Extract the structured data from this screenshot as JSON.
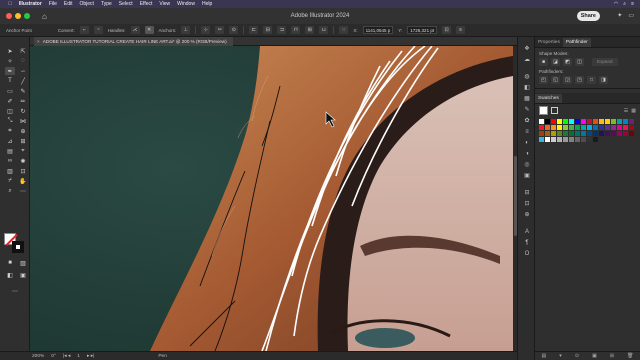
{
  "menubar": {
    "apple": "",
    "items": [
      "Illustrator",
      "File",
      "Edit",
      "Object",
      "Type",
      "Select",
      "Effect",
      "View",
      "Window",
      "Help"
    ]
  },
  "window": {
    "title": "Adobe Illustrator 2024",
    "share_label": "Share"
  },
  "controlbar": {
    "anchor_point_label": "Anchor Point",
    "convert_label": "Convert:",
    "handles_label": "Handles:",
    "anchors_label": "Anchors:",
    "x_value": "1141,0545 p",
    "y_value": "1725,321 pt"
  },
  "document": {
    "tab_title": "ADOBE ILLUSTRATOR TUTORIAL CREATE HAIR LINE ART.ai* @ 200 % (RGB/Preview)",
    "close_glyph": "×"
  },
  "statusbar": {
    "zoom": "200%",
    "rotation": "0°",
    "artboard": "1",
    "tool_name": "Pen"
  },
  "panels": {
    "tabs": [
      "Properties",
      "Pathfinder"
    ],
    "active_tab": "Pathfinder",
    "shape_modes_label": "Shape Modes:",
    "expand_label": "Expand",
    "pathfinders_label": "Pathfinders:",
    "swatches_tab": "Swatches"
  },
  "colors": {
    "menubar_bg": "#3a3550",
    "canvas_bg": "#243f3a",
    "hair": "#b86a3c",
    "skin": "#d8b7ab",
    "fill_slash": "#e0262b"
  },
  "swatches": [
    "#ffffff",
    "#000000",
    "#ff0000",
    "#ffff00",
    "#00ff00",
    "#00ffff",
    "#0000ff",
    "#ff00ff",
    "#c8102e",
    "#e35205",
    "#ffb81c",
    "#ffd100",
    "#78be20",
    "#00a3ad",
    "#0085ca",
    "#6d2077",
    "#ed1c24",
    "#f26522",
    "#f7941d",
    "#fff200",
    "#8dc63f",
    "#39b54a",
    "#00a651",
    "#00a99d",
    "#00aeef",
    "#0072bc",
    "#2e3192",
    "#662d91",
    "#92278f",
    "#ec008c",
    "#ed145b",
    "#9e0b0f",
    "#a0410d",
    "#a36209",
    "#aba000",
    "#598527",
    "#197b30",
    "#007236",
    "#00746b",
    "#0076a3",
    "#004a80",
    "#003471",
    "#1b1464",
    "#440e62",
    "#630460",
    "#9e005d",
    "#9e0039",
    "#790000",
    "#3bb4e0",
    "#ffffff",
    "#cccccc",
    "#b3b3b3",
    "#999999",
    "#808080",
    "#666666",
    "#4d4d4d",
    "#333333",
    "#1a1a1a"
  ]
}
